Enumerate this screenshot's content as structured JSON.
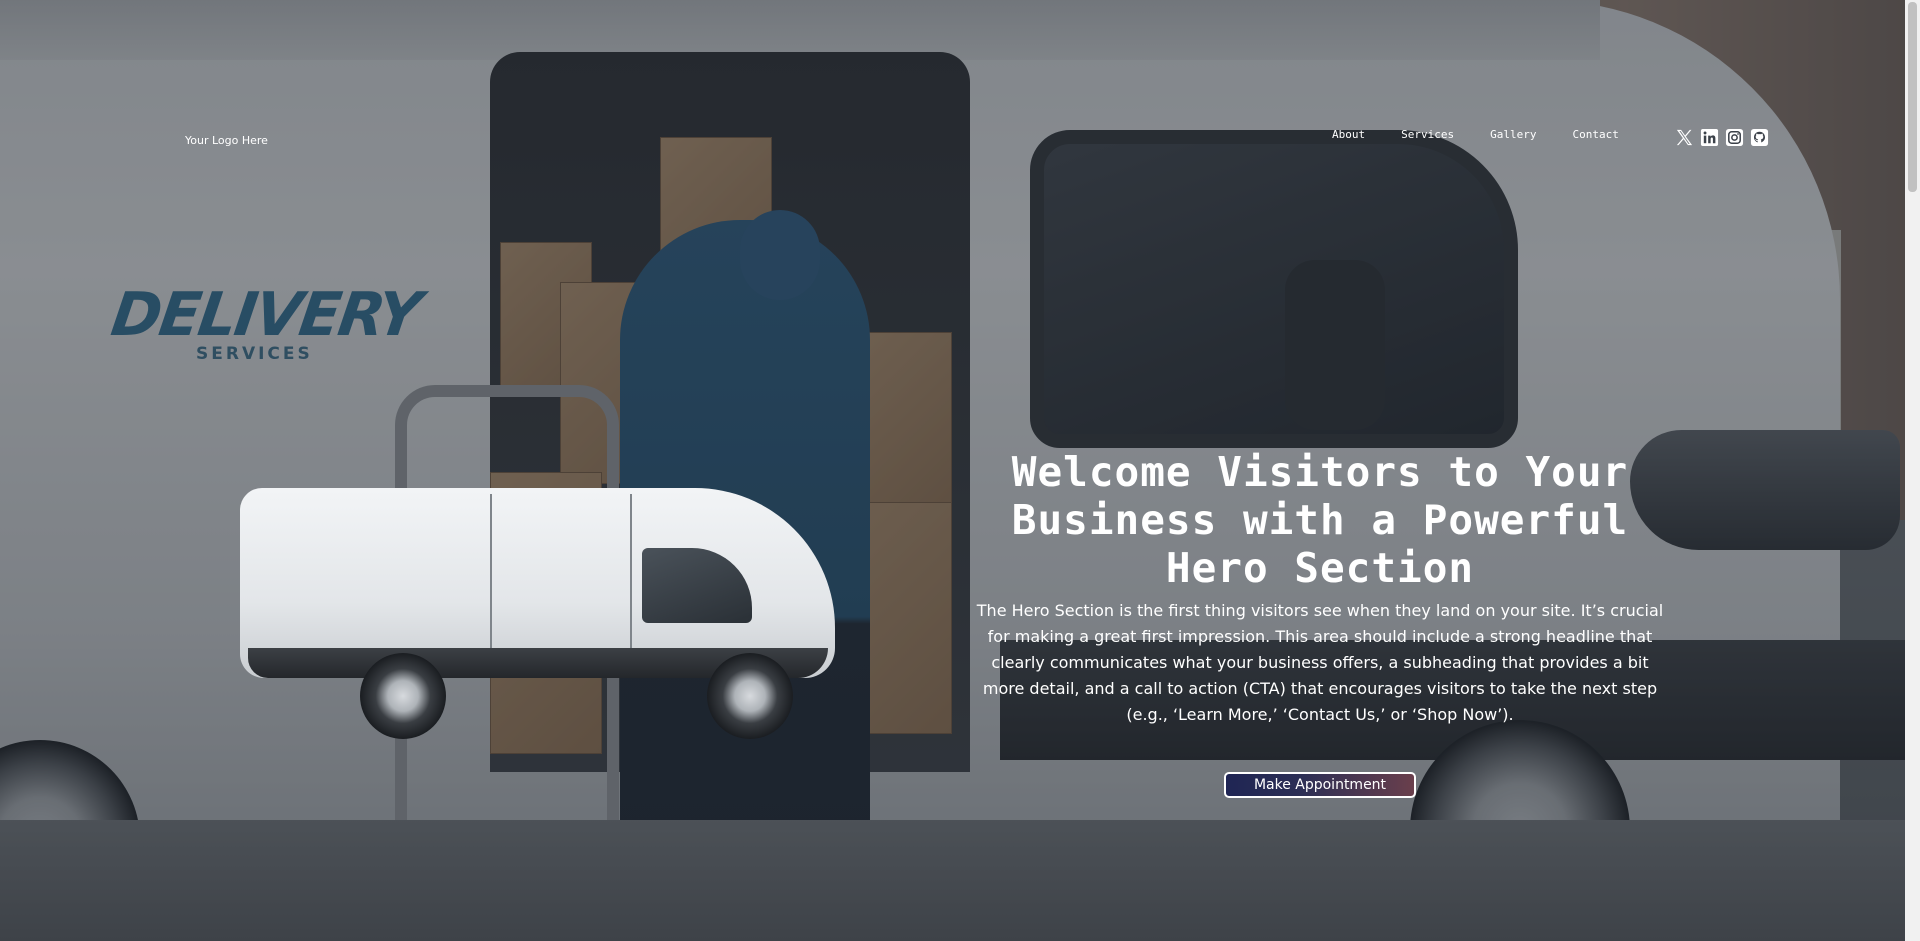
{
  "header": {
    "logo_text": "Your Logo Here",
    "nav": [
      "About",
      "Services",
      "Gallery",
      "Contact"
    ],
    "socials": [
      {
        "name": "x-icon"
      },
      {
        "name": "linkedin-icon"
      },
      {
        "name": "instagram-icon"
      },
      {
        "name": "github-icon"
      }
    ]
  },
  "background": {
    "van_print_title": "DELIVERY",
    "van_print_subtitle": "SERVICES"
  },
  "hero": {
    "title": "Welcome Visitors to Your Business with a Powerful Hero Section",
    "subtitle": "The Hero Section is the first thing visitors see when they land on your site. It’s crucial for making a great first impression. This area should include a strong headline that clearly communicates what your business offers, a subheading that provides a bit more detail, and a call to action (CTA) that encourages visitors to take the next step (e.g., ‘Learn More,’ ‘Contact Us,’ or ‘Shop Now’).",
    "cta_label": "Make Appointment"
  },
  "colors": {
    "text": "#ffffff",
    "cta_gradient_start": "#1f2554",
    "cta_gradient_end": "#6a3f4c",
    "van_print": "#2f6b8d"
  }
}
